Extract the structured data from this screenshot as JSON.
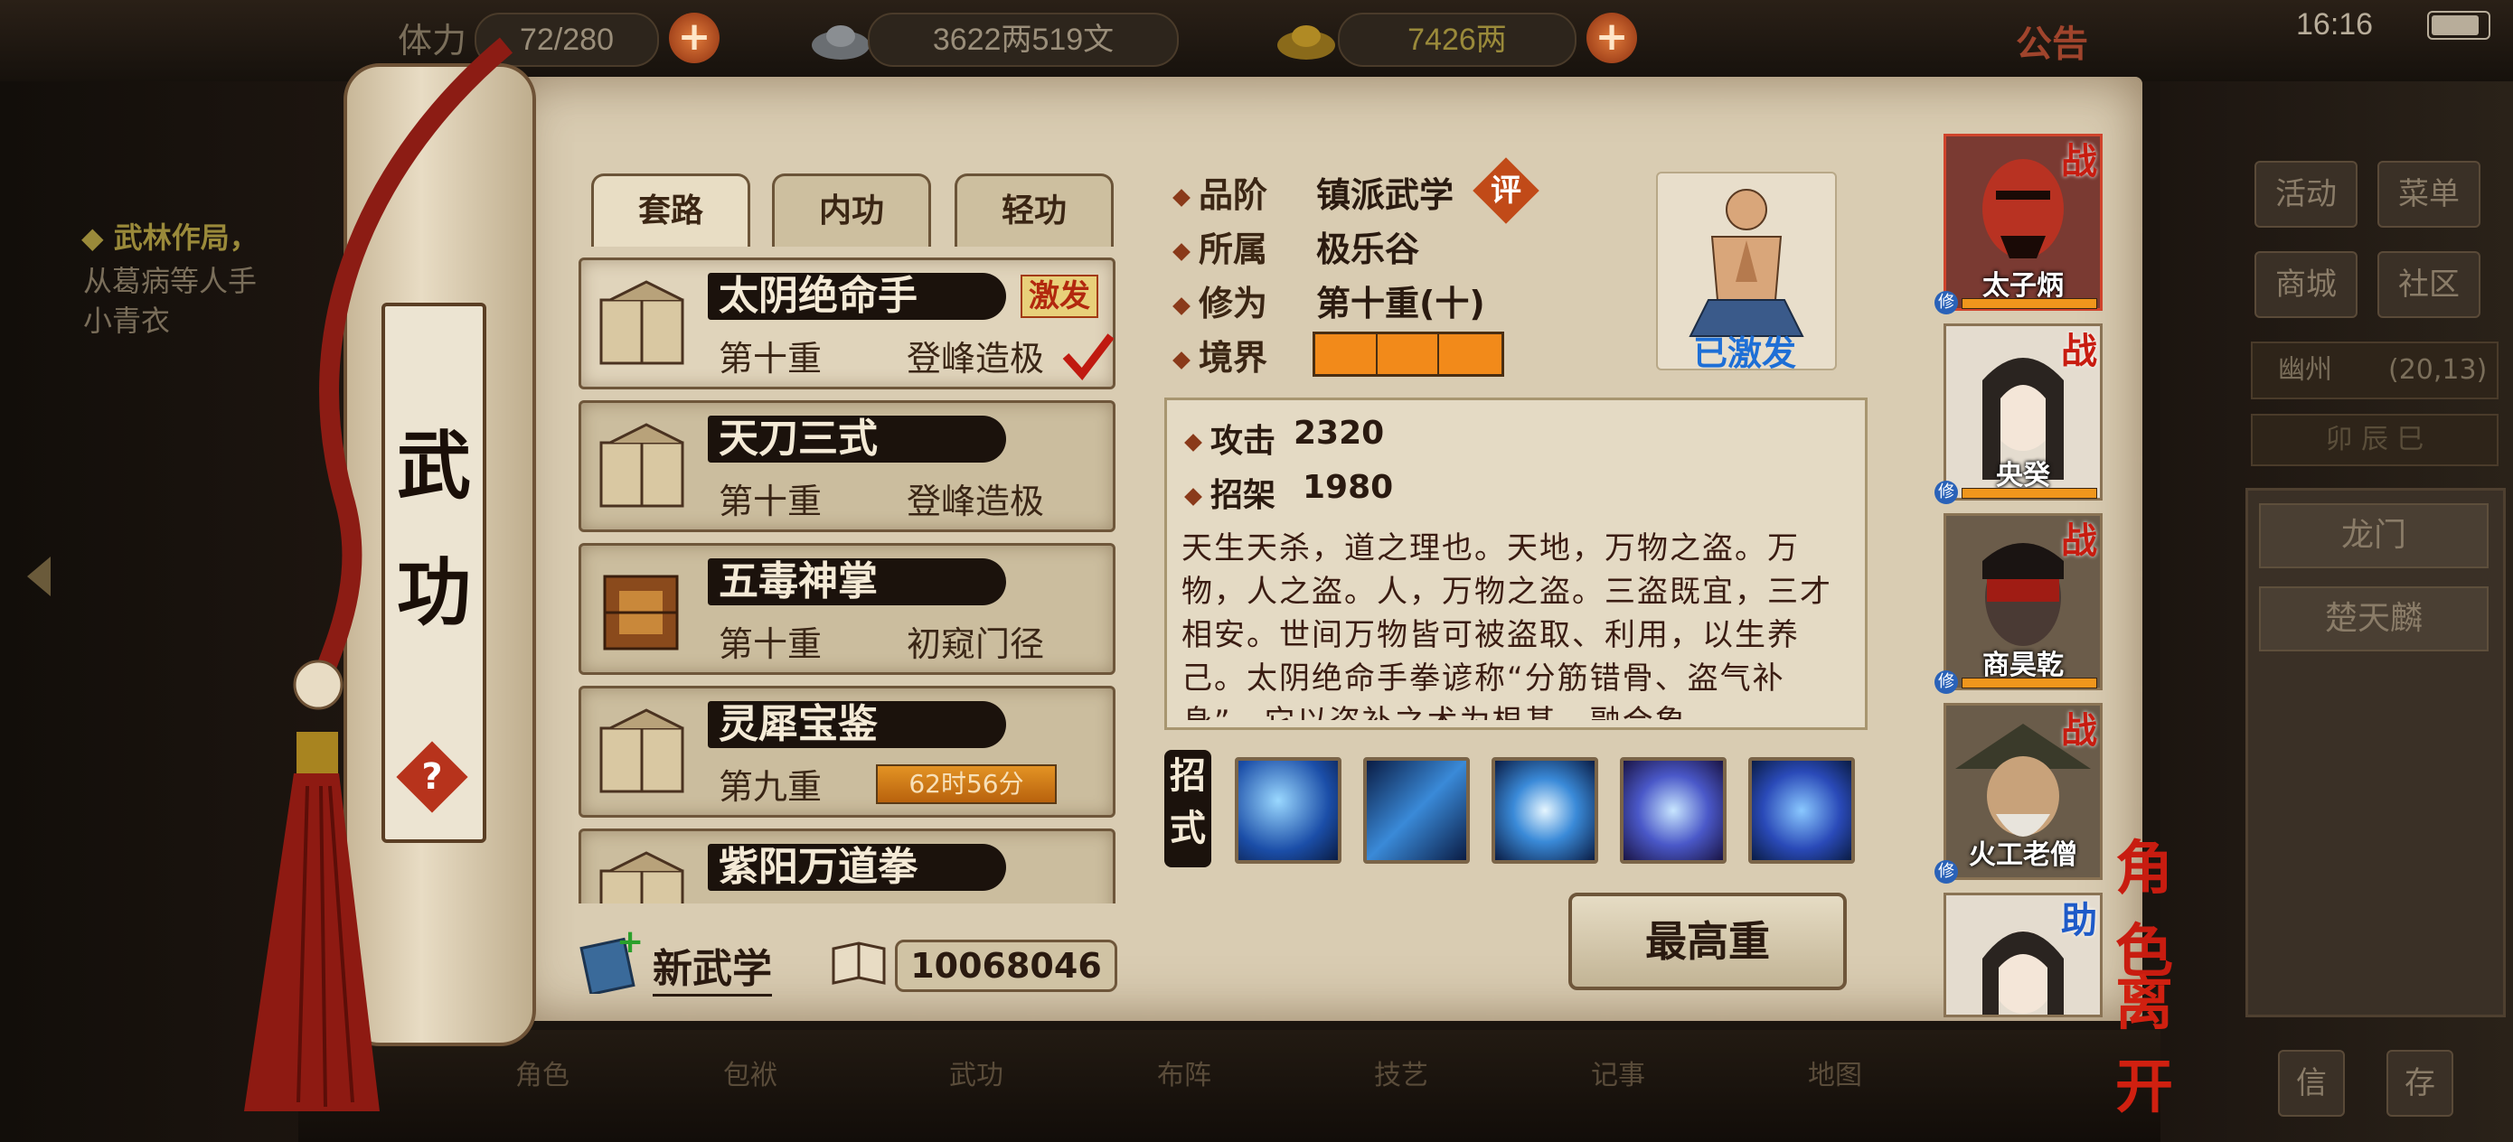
{
  "top_bar": {
    "stamina_label": "体力",
    "stamina_value": "72/280",
    "silver": "3622两519文",
    "gold": "7426两",
    "notice": "公告",
    "clock": "16:16"
  },
  "left_quest": {
    "title": "◆ 武林作局，",
    "line2": "从葛病等人手",
    "line3": "小青衣"
  },
  "right_menu": {
    "activity": "活动",
    "menu": "菜单",
    "shop": "商城",
    "community": "社区",
    "location": "幽州",
    "coords": "(20,13)",
    "time_row": "卯 辰 巳",
    "npc1": "龙门",
    "npc2": "楚天麟",
    "bottom1": "信",
    "bottom2": "存"
  },
  "bottom_nav": [
    "角色",
    "包袱",
    "武功",
    "布阵",
    "技艺",
    "记事",
    "地图"
  ],
  "scroll_title": [
    "武",
    "功"
  ],
  "help": "?",
  "tabs": [
    "套路",
    "内功",
    "轻功"
  ],
  "skills": [
    {
      "name": "太阴绝命手",
      "level": "第十重",
      "rank": "登峰造极",
      "badge": "激发",
      "checked": true
    },
    {
      "name": "天刀三式",
      "level": "第十重",
      "rank": "登峰造极"
    },
    {
      "name": "五毒神掌",
      "level": "第十重",
      "rank": "初窥门径"
    },
    {
      "name": "灵犀宝鉴",
      "level": "第九重",
      "timer": "62时56分"
    },
    {
      "name": "紫阳万道拳",
      "level": "",
      "rank": ""
    }
  ],
  "new_skill": "新武学",
  "points": "10068046",
  "info": {
    "grade_label": "品阶",
    "grade": "镇派武学",
    "eval": "评",
    "belong_label": "所属",
    "belong": "极乐谷",
    "cultivation_label": "修为",
    "cultivation": "第十重(十)",
    "realm_label": "境界",
    "realm_level": 3,
    "activated": "已激发"
  },
  "stats": {
    "attack_label": "攻击",
    "attack": "2320",
    "parry_label": "招架",
    "parry": "1980"
  },
  "description": "天生天杀，道之理也。天地，万物之盗。万物，人之盗。人，万物之盗。三盗既宜，三才相安。世间万物皆可被盗取、利用，以生养己。太阴绝命手拳谚称“分筋错骨、盗气补身”，它以盗补之术为根基，融合象",
  "moves_label": "招式",
  "max_button": "最高重",
  "characters": [
    {
      "name": "太子炳",
      "badge": "战",
      "selected": true
    },
    {
      "name": "央癸",
      "badge": "战"
    },
    {
      "name": "商昊乾",
      "badge": "战"
    },
    {
      "name": "火工老僧",
      "badge": "战"
    },
    {
      "name": "",
      "badge": "助"
    }
  ],
  "xiu": "修",
  "role_button": "角色",
  "leave_button": "离开",
  "colors": {
    "accent_red": "#c81c10",
    "activated_blue": "#1e6fd6",
    "bar_orange": "#f28a1a"
  }
}
